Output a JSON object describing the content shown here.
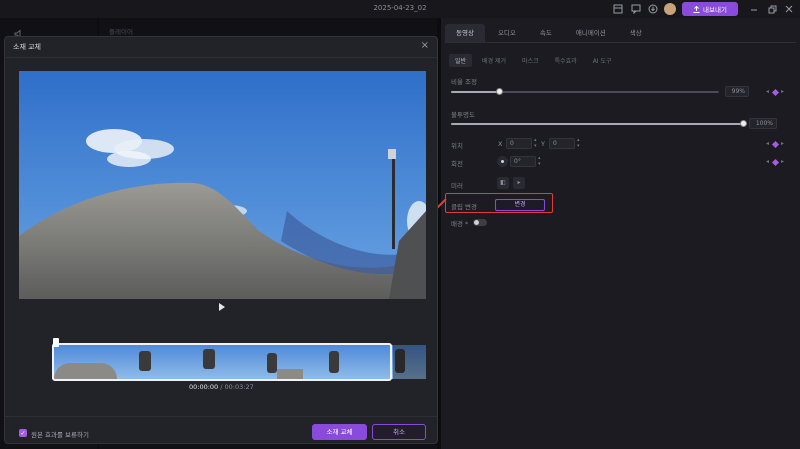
{
  "window": {
    "title": "2025-04-23_02"
  },
  "header": {
    "export_label": "내보내기"
  },
  "left_panel": {
    "label": "플레이어"
  },
  "properties": {
    "tabs": [
      "동영상",
      "오디오",
      "속도",
      "애니메이션",
      "색상"
    ],
    "subtabs": [
      "일반",
      "배경 제거",
      "마스크",
      "특수효과",
      "AI 도구"
    ],
    "scale_label": "비율 조정",
    "scale_value": "99%",
    "scale_level": 0.18,
    "opacity_label": "불투명도",
    "opacity_value": "100%",
    "opacity_level": 1.0,
    "position_label": "위치",
    "pos_x_label": "X",
    "pos_x_value": "0",
    "pos_y_label": "Y",
    "pos_y_value": "0",
    "rotate_label": "회전",
    "rotate_value": "0°",
    "mirror_label": "미러",
    "clip_replace_label": "클립 변경",
    "change_button": "변경",
    "background_label": "배경 *"
  },
  "dialog": {
    "title": "소재 교체",
    "current_time": "00:00:00",
    "separator": " / ",
    "duration": "00:03:27",
    "keep_effects_label": "원본 효과를 보류하기",
    "replace_button": "소재 교체",
    "cancel_button": "취소"
  },
  "colors": {
    "accent": "#8a4bdc",
    "highlight_box": "#e23b3b",
    "background": "#141419",
    "panel": "#1b1b21"
  }
}
